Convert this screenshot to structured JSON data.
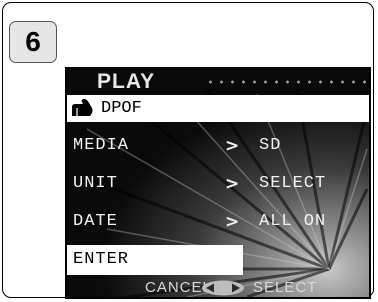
{
  "step": "6",
  "header": {
    "title": "PLAY"
  },
  "submenu": {
    "label": "DPOF",
    "icon": "hand-pointer-icon"
  },
  "menu": [
    {
      "label": "MEDIA",
      "arrow": ">",
      "value": "SD"
    },
    {
      "label": "UNIT",
      "arrow": ">",
      "value": "SELECT"
    },
    {
      "label": "DATE",
      "arrow": ">",
      "value": "ALL ON"
    }
  ],
  "enter": {
    "label": "ENTER"
  },
  "footer": {
    "cancel": "CANCEL",
    "select": "SELECT",
    "nav_icon": "left-right-dpad-icon"
  }
}
